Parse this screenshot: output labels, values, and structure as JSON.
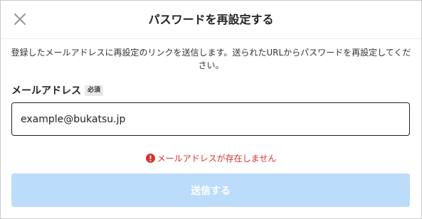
{
  "dialog": {
    "title": "パスワードを再設定する",
    "close_icon": "close-icon",
    "description": "登録したメールアドレスに再設定のリンクを送信します。送られたURLからパスワードを再設定してください。"
  },
  "form": {
    "email_label": "メールアドレス",
    "required_badge": "必須",
    "email_value": "example@bukatsu.jp",
    "error_icon": "exclamation-circle-icon",
    "error_message": "メールアドレスが存在しません",
    "error_color": "#d93232",
    "submit_label": "送信する",
    "submit_color_disabled": "#bcdcfb"
  }
}
